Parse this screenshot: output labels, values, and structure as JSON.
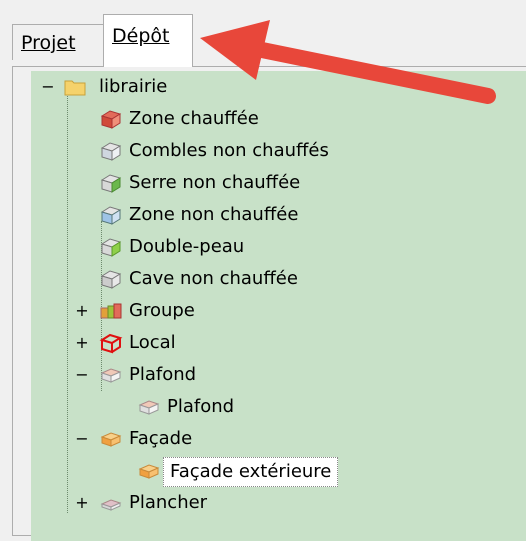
{
  "tabs": [
    {
      "label": "Projet",
      "active": false
    },
    {
      "label": "Dépôt",
      "active": true
    }
  ],
  "tree": {
    "root": {
      "label": "librairie",
      "toggle": "−",
      "icon": "folder-icon"
    },
    "items": [
      {
        "label": "Zone chauffée",
        "icon": "heated-zone-icon"
      },
      {
        "label": "Combles non chauffés",
        "icon": "unheated-attic-icon"
      },
      {
        "label": "Serre non chauffée",
        "icon": "unheated-greenhouse-icon"
      },
      {
        "label": "Zone non chauffée",
        "icon": "unheated-zone-icon"
      },
      {
        "label": "Double-peau",
        "icon": "double-skin-icon"
      },
      {
        "label": "Cave non chauffée",
        "icon": "unheated-cellar-icon"
      },
      {
        "label": "Groupe",
        "toggle": "+",
        "icon": "group-icon"
      },
      {
        "label": "Local",
        "toggle": "+",
        "icon": "local-icon"
      },
      {
        "label": "Plafond",
        "toggle": "−",
        "icon": "ceiling-icon"
      },
      {
        "label": "Plafond",
        "icon": "ceiling-icon"
      },
      {
        "label": "Façade",
        "toggle": "−",
        "icon": "facade-icon"
      },
      {
        "label": "Façade extérieure",
        "icon": "exterior-facade-icon",
        "selected": true
      },
      {
        "label": "Plancher",
        "toggle": "+",
        "icon": "floor-icon"
      }
    ]
  },
  "colors": {
    "tree_background": "#c8e1c8",
    "arrow": "#e8473a"
  }
}
